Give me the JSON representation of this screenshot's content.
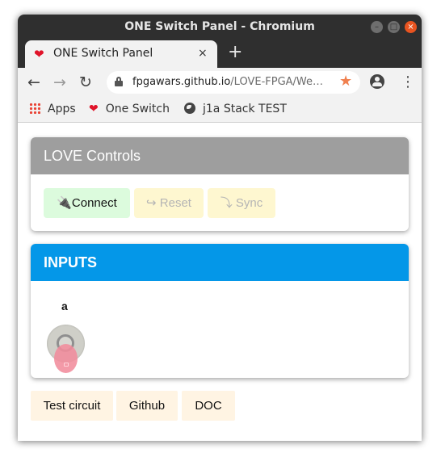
{
  "window": {
    "title": "ONE Switch Panel - Chromium",
    "controls": {
      "minimize": "–",
      "maximize": "□",
      "close": "×"
    }
  },
  "tab": {
    "favicon": "heart-icon",
    "title": "ONE Switch Panel",
    "close": "×",
    "new_tab": "+"
  },
  "toolbar": {
    "back": "←",
    "forward": "→",
    "reload": "↻",
    "url_host": "fpgawars.github.io",
    "url_path": "/LOVE-FPGA/We…",
    "bookmark_star": "★",
    "menu": "⋮"
  },
  "bookmarks": [
    {
      "label": "Apps",
      "icon": "apps-grid-icon"
    },
    {
      "label": "One Switch",
      "icon": "heart-icon"
    },
    {
      "label": "j1a Stack TEST",
      "icon": "globe-icon"
    }
  ],
  "controls_card": {
    "title": "LOVE Controls",
    "buttons": [
      {
        "icon": "plug-icon",
        "glyph": "🔌",
        "label": "Connect",
        "enabled": true
      },
      {
        "icon": "redo-icon",
        "glyph": "↪",
        "label": "Reset",
        "enabled": false
      },
      {
        "icon": "sync-icon",
        "glyph": "⤵",
        "label": "Sync",
        "enabled": false
      }
    ]
  },
  "inputs_card": {
    "title": "INPUTS",
    "inputs": [
      {
        "label": "a",
        "state": "off"
      }
    ]
  },
  "footer": {
    "buttons": [
      "Test circuit",
      "Github",
      "DOC"
    ]
  },
  "colors": {
    "controls_header": "#9e9e9e",
    "inputs_header": "#0497e8",
    "connect_bg": "#dcfbdd",
    "disabled_bg": "#fef7d0",
    "footer_button_bg": "#fff4e3"
  }
}
